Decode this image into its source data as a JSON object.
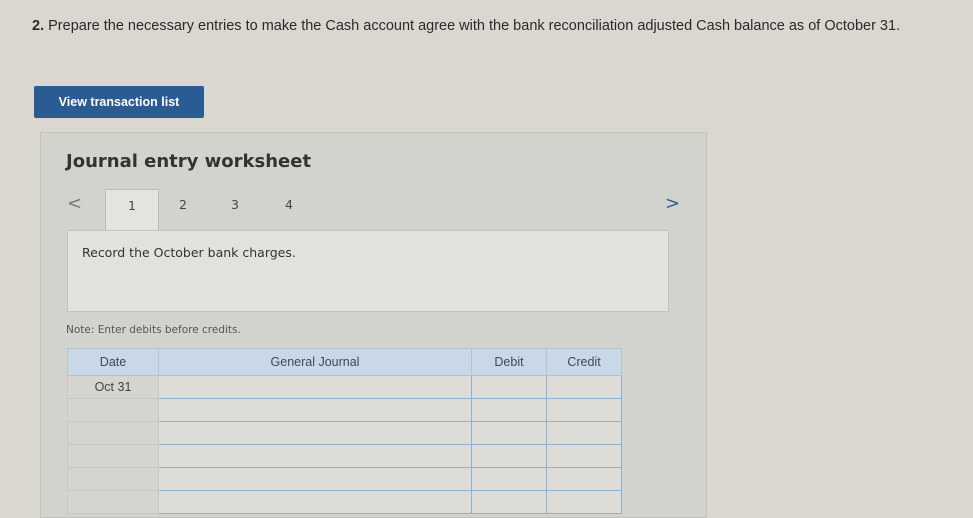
{
  "question": {
    "number": "2.",
    "text": "Prepare the necessary entries to make the Cash account agree with the bank reconciliation adjusted Cash balance as of October 31."
  },
  "view_transaction_button": "View transaction list",
  "worksheet": {
    "title": "Journal entry worksheet",
    "prev_icon": "<",
    "next_icon": ">",
    "tabs": [
      "1",
      "2",
      "3",
      "4"
    ],
    "active_tab": "1",
    "instruction": "Record the October bank charges.",
    "note": "Note: Enter debits before credits."
  },
  "journal": {
    "headers": {
      "date": "Date",
      "account": "General Journal",
      "debit": "Debit",
      "credit": "Credit"
    },
    "rows": [
      {
        "date": "Oct 31",
        "account": "",
        "debit": "",
        "credit": ""
      },
      {
        "date": "",
        "account": "",
        "debit": "",
        "credit": ""
      },
      {
        "date": "",
        "account": "",
        "debit": "",
        "credit": ""
      },
      {
        "date": "",
        "account": "",
        "debit": "",
        "credit": ""
      },
      {
        "date": "",
        "account": "",
        "debit": "",
        "credit": ""
      },
      {
        "date": "",
        "account": "",
        "debit": "",
        "credit": ""
      }
    ]
  },
  "colors": {
    "button": "#2a5b93",
    "header_bg": "#c9d8e6",
    "cell_border": "#8fb0cf"
  }
}
